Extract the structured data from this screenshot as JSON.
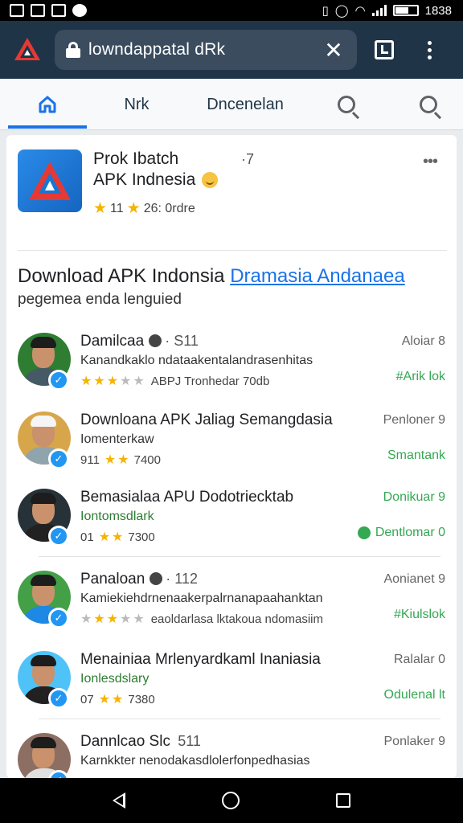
{
  "status_bar": {
    "time": "1838"
  },
  "browser": {
    "url": "lowndappatal dRk",
    "close_glyph": "✕"
  },
  "nav_tabs": [
    "Nrk",
    "Dncenelan"
  ],
  "app": {
    "name": "Prok Ibatch",
    "count": "·7",
    "subtitle": "APK Indnesia",
    "rating": "11",
    "rating_extra": "26: 0rdre",
    "more": "•••"
  },
  "headline": {
    "text": "Download APK Indonsia",
    "link": "Dramasia Andanaea"
  },
  "subhead": "pegemea enda lenguied",
  "rows": [
    {
      "title": "Damilcaa",
      "count": "· S11",
      "desc": "Kanandkaklo ndataakentalandrasenhitas",
      "meta_stars": 3,
      "meta_text": "ABPJ Tronhedar 70db",
      "right_top": "Aloiar 8",
      "right_bottom": "#Arik lok"
    },
    {
      "title": "Downloana APK Jaliag Semangdasia",
      "count": "",
      "desc": "Iomenterkaw",
      "meta_prefix": "911",
      "meta_stars": 2,
      "meta_text": "7400",
      "right_top": "Penloner 9",
      "right_bottom": "Smantank"
    },
    {
      "title": "Bemasialaa APU Dodotriecktab",
      "count": "",
      "desc": "Iontomsdlark",
      "meta_prefix": "01",
      "meta_stars": 2,
      "meta_text": "7300",
      "right_top": "Donikuar 9",
      "right_bottom": "Dentlomar 0"
    },
    {
      "title": "Panaloan",
      "count": "· 112",
      "desc": "Kamiekiehdrnenaakerpalrnanapaahanktan",
      "meta_stars": 3,
      "meta_text": "eaoldarlasa lktakoua ndomasiim",
      "right_top": "Aonianet 9",
      "right_bottom": "#Kiulslok"
    },
    {
      "title": "Menainiaa Mrlenyardkaml Inaniasia",
      "count": "",
      "desc": "Ionlesdslary",
      "meta_prefix": "07",
      "meta_stars": 2,
      "meta_text": "7380",
      "right_top": "Ralalar 0",
      "right_bottom": "Odulenal lt"
    },
    {
      "title": "Dannlcao Slc",
      "count": "511",
      "desc": "Karnkkter nenodakasdlolerfonpedhasias",
      "meta_stars": 0,
      "meta_text": "",
      "right_top": "Ponlaker 9",
      "right_bottom": ""
    }
  ],
  "colors": {
    "toolbar": "#1f3447",
    "accent": "#1a73e8",
    "green": "#34a853",
    "star": "#f4b400"
  }
}
